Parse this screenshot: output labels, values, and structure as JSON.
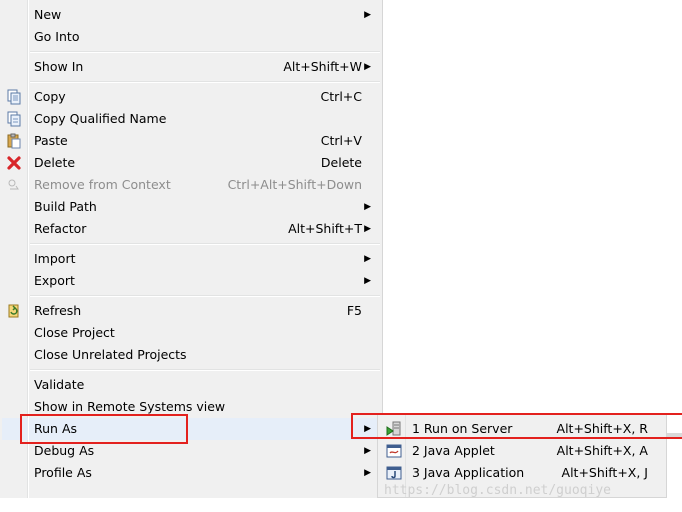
{
  "menu": {
    "items": [
      {
        "label": "New",
        "shortcut": "",
        "arrow": "▶"
      },
      {
        "label": "Go Into",
        "shortcut": "",
        "arrow": ""
      },
      {
        "label": "Show In",
        "shortcut": "Alt+Shift+W",
        "arrow": "▶"
      },
      {
        "label": "Copy",
        "shortcut": "Ctrl+C",
        "arrow": ""
      },
      {
        "label": "Copy Qualified Name",
        "shortcut": "",
        "arrow": ""
      },
      {
        "label": "Paste",
        "shortcut": "Ctrl+V",
        "arrow": ""
      },
      {
        "label": "Delete",
        "shortcut": "Delete",
        "arrow": ""
      },
      {
        "label": "Remove from Context",
        "shortcut": "Ctrl+Alt+Shift+Down",
        "arrow": ""
      },
      {
        "label": "Build Path",
        "shortcut": "",
        "arrow": "▶"
      },
      {
        "label": "Refactor",
        "shortcut": "Alt+Shift+T",
        "arrow": "▶"
      },
      {
        "label": "Import",
        "shortcut": "",
        "arrow": "▶"
      },
      {
        "label": "Export",
        "shortcut": "",
        "arrow": "▶"
      },
      {
        "label": "Refresh",
        "shortcut": "F5",
        "arrow": ""
      },
      {
        "label": "Close Project",
        "shortcut": "",
        "arrow": ""
      },
      {
        "label": "Close Unrelated Projects",
        "shortcut": "",
        "arrow": ""
      },
      {
        "label": "Validate",
        "shortcut": "",
        "arrow": ""
      },
      {
        "label": "Show in Remote Systems view",
        "shortcut": "",
        "arrow": ""
      },
      {
        "label": "Run As",
        "shortcut": "",
        "arrow": "▶"
      },
      {
        "label": "Debug As",
        "shortcut": "",
        "arrow": "▶"
      },
      {
        "label": "Profile As",
        "shortcut": "",
        "arrow": "▶"
      }
    ]
  },
  "submenu": {
    "items": [
      {
        "label": "1 Run on Server",
        "shortcut": "Alt+Shift+X, R"
      },
      {
        "label": "2 Java Applet",
        "shortcut": "Alt+Shift+X, A"
      },
      {
        "label": "3 Java Application",
        "shortcut": "Alt+Shift+X, J"
      }
    ]
  },
  "watermark": "https://blog.csdn.net/guoqiye",
  "icons": {
    "copy": "copy-icon",
    "paste": "paste-icon",
    "delete": "delete-icon",
    "remove": "remove-context-icon",
    "refresh": "refresh-icon",
    "server": "run-on-server-icon",
    "applet": "java-applet-icon",
    "app": "java-application-icon"
  },
  "colors": {
    "highlight_border": "#e3211e",
    "menu_bg": "#f0f0f0",
    "hover_bg": "#e6eef9"
  }
}
